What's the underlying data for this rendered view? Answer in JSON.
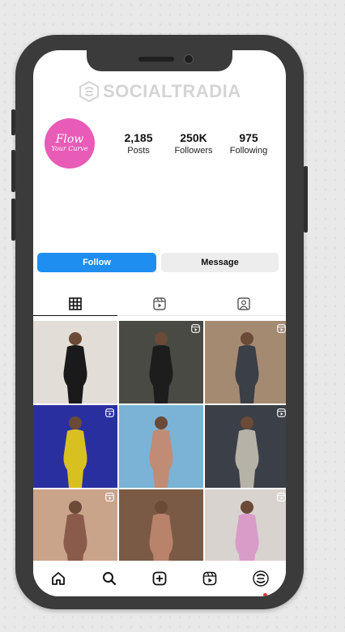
{
  "watermark": {
    "text": "SOCIALTRADIA"
  },
  "profile": {
    "avatar_line1": "Flow",
    "avatar_line2": "Your Curve",
    "stats": [
      {
        "value": "2,185",
        "label": "Posts"
      },
      {
        "value": "250K",
        "label": "Followers"
      },
      {
        "value": "975",
        "label": "Following"
      }
    ]
  },
  "actions": {
    "follow_label": "Follow",
    "message_label": "Message"
  },
  "tabs": [
    {
      "icon": "grid-icon",
      "active": true
    },
    {
      "icon": "reels-icon",
      "active": false
    },
    {
      "icon": "tagged-icon",
      "active": false
    }
  ],
  "posts": [
    {
      "bg": "#e2ddd6",
      "figure": "#1a1a1a",
      "reel": false
    },
    {
      "bg": "#4a4a45",
      "figure": "#1d1d1d",
      "reel": true
    },
    {
      "bg": "#a58a72",
      "figure": "#3b3f46",
      "reel": true
    },
    {
      "bg": "#2a2fa0",
      "figure": "#d8c020",
      "reel": true
    },
    {
      "bg": "#7ab3d6",
      "figure": "#c08c76",
      "reel": false
    },
    {
      "bg": "#3a3f48",
      "figure": "#b7b2a8",
      "reel": true
    },
    {
      "bg": "#c9a48a",
      "figure": "#8a5b4a",
      "reel": true
    },
    {
      "bg": "#7a5a45",
      "figure": "#b9826a",
      "reel": false
    },
    {
      "bg": "#d9d3cf",
      "figure": "#d99bc8",
      "reel": true
    }
  ],
  "colors": {
    "accent": "#1e8ef1",
    "avatar": "#e85bb7"
  }
}
